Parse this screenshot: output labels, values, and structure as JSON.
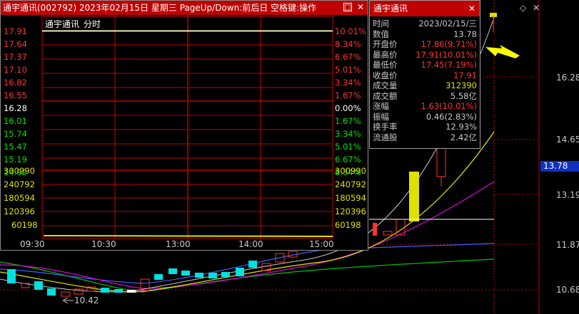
{
  "colors": {
    "up": "#ff3232",
    "down": "#00e0e0",
    "flat": "#ffffff",
    "grid": "#c00000",
    "volume": "#e0e000",
    "axis_text": "#c8c8c8",
    "line_yellow": "#e6e600",
    "line_magenta": "#e000e0",
    "line_green": "#00c000",
    "line_blue": "#4060ff",
    "title_bar": "#c00000"
  },
  "intraday": {
    "title": "通宇通讯(002792) 2023年02月15日 星期三 PageUp/Down:前后日 空格键:操作",
    "restore_icon": "□",
    "close_icon": "✕",
    "stock_label": "通宇通讯",
    "chart_type_label": "分时",
    "price_ticks": [
      "17.91",
      "17.64",
      "17.37",
      "17.10",
      "16.82",
      "16.55",
      "16.28",
      "16.01",
      "15.74",
      "15.47",
      "15.19",
      "14.92"
    ],
    "pct_ticks": [
      "10.01%",
      "8.34%",
      "6.67%",
      "5.01%",
      "3.34%",
      "1.67%",
      "0.00%",
      "1.67%",
      "3.34%",
      "5.01%",
      "6.67%",
      "8.34%"
    ],
    "volume_ticks": [
      "300990",
      "240792",
      "180594",
      "120396",
      "60198"
    ],
    "time_ticks": [
      "09:30",
      "10:30",
      "13:00",
      "14:00",
      "15:00"
    ]
  },
  "info_panel": {
    "title": "通宇通讯",
    "close_icon": "✕",
    "rows": [
      {
        "label": "时间",
        "value": "2023/02/15/三",
        "color": "#c8c8c8"
      },
      {
        "label": "数值",
        "value": "13.78",
        "color": "#c8c8c8"
      },
      {
        "label": "开盘价",
        "value": "17.86(9.71%)",
        "color": "#ff3232"
      },
      {
        "label": "最高价",
        "value": "17.91(10.01%)",
        "color": "#ff3232"
      },
      {
        "label": "最低价",
        "value": "17.45(7.19%)",
        "color": "#ff3232"
      },
      {
        "label": "收盘价",
        "value": "17.91",
        "color": "#ff3232"
      },
      {
        "label": "成交量",
        "value": "312390",
        "color": "#e0e000"
      },
      {
        "label": "成交额",
        "value": "5.58亿",
        "color": "#c8c8c8"
      },
      {
        "label": "涨幅",
        "value": "1.63(10.01%)",
        "color": "#ff3232"
      },
      {
        "label": "振幅",
        "value": "0.46(2.83%)",
        "color": "#c8c8c8"
      },
      {
        "label": "换手率",
        "value": "12.93%",
        "color": "#c8c8c8"
      },
      {
        "label": "流通股",
        "value": "2.42亿",
        "color": "#c8c8c8"
      }
    ]
  },
  "kline": {
    "price_axis": [
      "16.28",
      "14.65",
      "13.19",
      "11.87",
      "10.68"
    ],
    "cursor_value": "13.78",
    "low_marker": "10.42",
    "diamond_icon": "◇",
    "x_icon": "✕"
  }
}
